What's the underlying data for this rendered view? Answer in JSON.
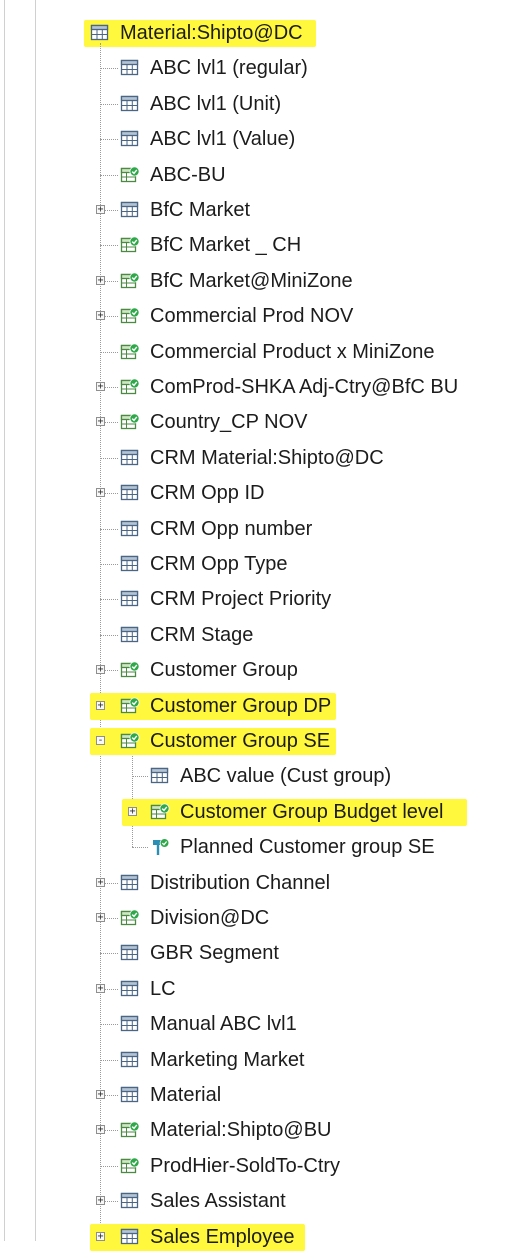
{
  "tree": {
    "root": {
      "label": "Material:Shipto@DC",
      "icon": "table-icon",
      "expanded": true,
      "highlighted": true
    },
    "items": [
      {
        "label": "ABC lvl1 (regular)",
        "icon": "table-icon",
        "level": 1,
        "expander": null,
        "highlighted": false
      },
      {
        "label": "ABC lvl1 (Unit)",
        "icon": "table-icon",
        "level": 1,
        "expander": null,
        "highlighted": false
      },
      {
        "label": "ABC lvl1 (Value)",
        "icon": "table-icon",
        "level": 1,
        "expander": null,
        "highlighted": false
      },
      {
        "label": "ABC-BU",
        "icon": "linked-table-icon",
        "level": 1,
        "expander": null,
        "highlighted": false
      },
      {
        "label": "BfC Market",
        "icon": "table-icon",
        "level": 1,
        "expander": "+",
        "highlighted": false
      },
      {
        "label": "BfC Market _ CH",
        "icon": "linked-table-icon",
        "level": 1,
        "expander": null,
        "highlighted": false
      },
      {
        "label": "BfC Market@MiniZone",
        "icon": "linked-table-icon",
        "level": 1,
        "expander": "+",
        "highlighted": false
      },
      {
        "label": "Commercial Prod NOV",
        "icon": "linked-table-icon",
        "level": 1,
        "expander": "+",
        "highlighted": false
      },
      {
        "label": "Commercial Product x MiniZone",
        "icon": "linked-table-icon",
        "level": 1,
        "expander": null,
        "highlighted": false
      },
      {
        "label": "ComProd-SHKA Adj-Ctry@BfC BU",
        "icon": "linked-table-icon",
        "level": 1,
        "expander": "+",
        "highlighted": false
      },
      {
        "label": "Country_CP NOV",
        "icon": "linked-table-icon",
        "level": 1,
        "expander": "+",
        "highlighted": false
      },
      {
        "label": "CRM Material:Shipto@DC",
        "icon": "table-icon",
        "level": 1,
        "expander": null,
        "highlighted": false
      },
      {
        "label": "CRM Opp ID",
        "icon": "table-icon",
        "level": 1,
        "expander": "+",
        "highlighted": false
      },
      {
        "label": "CRM Opp number",
        "icon": "table-icon",
        "level": 1,
        "expander": null,
        "highlighted": false
      },
      {
        "label": "CRM Opp Type",
        "icon": "table-icon",
        "level": 1,
        "expander": null,
        "highlighted": false
      },
      {
        "label": "CRM Project Priority",
        "icon": "table-icon",
        "level": 1,
        "expander": null,
        "highlighted": false
      },
      {
        "label": "CRM Stage",
        "icon": "table-icon",
        "level": 1,
        "expander": null,
        "highlighted": false
      },
      {
        "label": "Customer Group",
        "icon": "linked-table-icon",
        "level": 1,
        "expander": "+",
        "highlighted": false
      },
      {
        "label": "Customer Group DP",
        "icon": "linked-table-icon",
        "level": 1,
        "expander": "+",
        "highlighted": true
      },
      {
        "label": "Customer Group SE",
        "icon": "linked-table-icon",
        "level": 1,
        "expander": "-",
        "highlighted": true
      },
      {
        "label": "ABC value (Cust group)",
        "icon": "table-icon",
        "level": 2,
        "expander": null,
        "highlighted": false
      },
      {
        "label": "Customer Group Budget level",
        "icon": "linked-table-icon",
        "level": 2,
        "expander": "+",
        "highlighted": true
      },
      {
        "label": "Planned Customer group SE",
        "icon": "planned-icon",
        "level": 2,
        "expander": null,
        "highlighted": false
      },
      {
        "label": "Distribution Channel",
        "icon": "table-icon",
        "level": 1,
        "expander": "+",
        "highlighted": false
      },
      {
        "label": "Division@DC",
        "icon": "linked-table-icon",
        "level": 1,
        "expander": "+",
        "highlighted": false
      },
      {
        "label": "GBR Segment",
        "icon": "table-icon",
        "level": 1,
        "expander": null,
        "highlighted": false
      },
      {
        "label": "LC",
        "icon": "table-icon",
        "level": 1,
        "expander": "+",
        "highlighted": false
      },
      {
        "label": "Manual ABC lvl1",
        "icon": "table-icon",
        "level": 1,
        "expander": null,
        "highlighted": false
      },
      {
        "label": "Marketing Market",
        "icon": "table-icon",
        "level": 1,
        "expander": null,
        "highlighted": false
      },
      {
        "label": "Material",
        "icon": "table-icon",
        "level": 1,
        "expander": "+",
        "highlighted": false
      },
      {
        "label": "Material:Shipto@BU",
        "icon": "linked-table-icon",
        "level": 1,
        "expander": "+",
        "highlighted": false
      },
      {
        "label": "ProdHier-SoldTo-Ctry",
        "icon": "linked-table-icon",
        "level": 1,
        "expander": null,
        "highlighted": false
      },
      {
        "label": "Sales Assistant",
        "icon": "table-icon",
        "level": 1,
        "expander": "+",
        "highlighted": false
      },
      {
        "label": "Sales Employee",
        "icon": "table-icon",
        "level": 1,
        "expander": "+",
        "highlighted": true
      }
    ]
  },
  "colors": {
    "highlight": "#fff83c",
    "table_border": "#4a6684",
    "table_header": "#b5c4d4",
    "linked_border": "#4c8a43",
    "linked_badge": "#2fa84a",
    "planned": "#2b8fb5",
    "text": "#1c1c1c"
  }
}
